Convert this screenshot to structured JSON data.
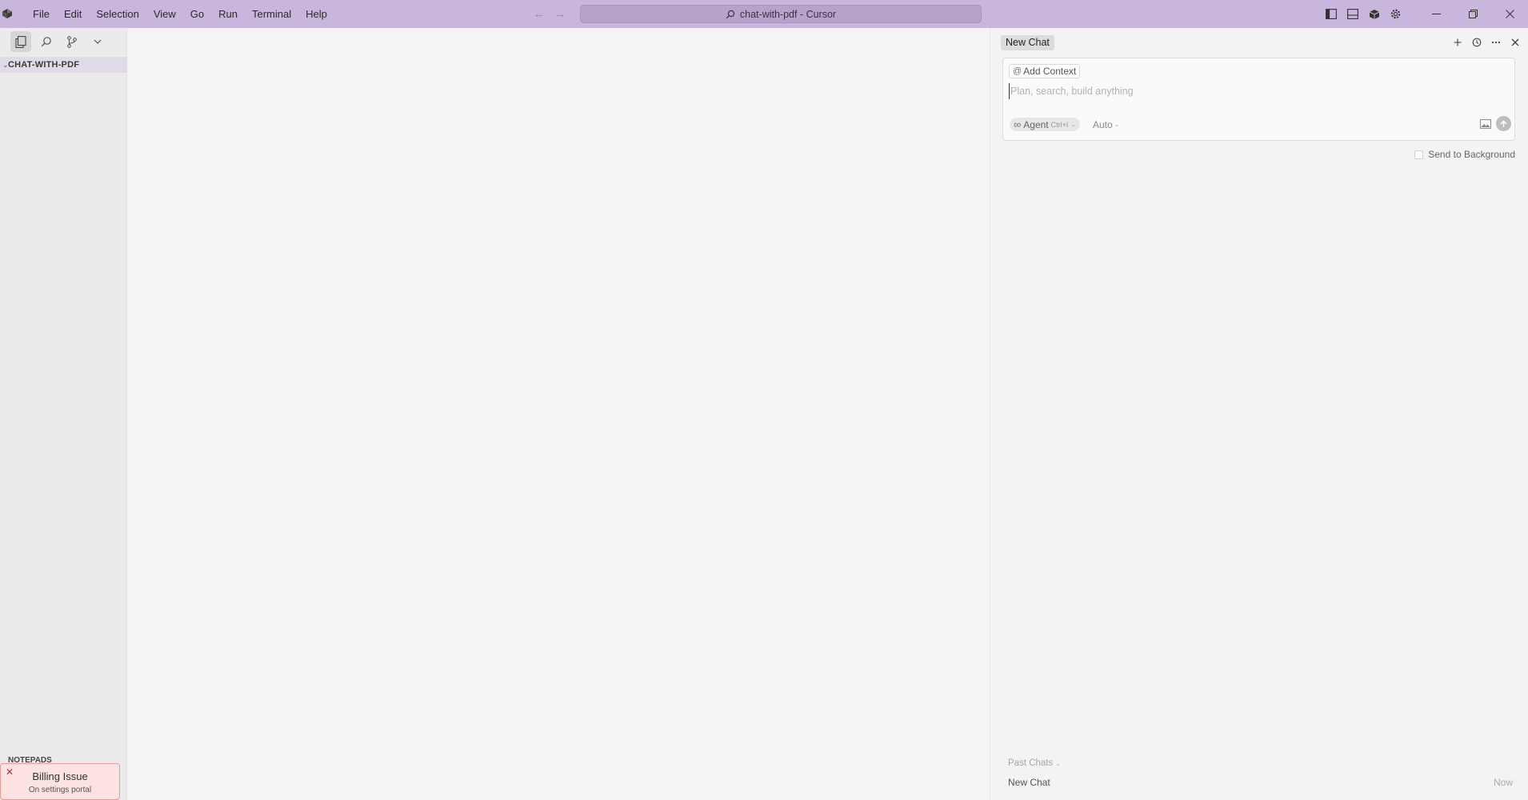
{
  "window": {
    "title": "chat-with-pdf - Cursor"
  },
  "menu": {
    "items": [
      "File",
      "Edit",
      "Selection",
      "View",
      "Go",
      "Run",
      "Terminal",
      "Help"
    ]
  },
  "icons": {
    "app_logo": "cursor-logo-icon",
    "back": "arrow-left-icon",
    "forward": "arrow-right-icon",
    "search": "search-icon",
    "toggle_sidebar": "layout-sidebar-icon",
    "toggle_panel": "layout-panel-icon",
    "extensions": "cube-icon",
    "settings": "gear-icon",
    "minimize": "minimize-icon",
    "restore": "restore-icon",
    "close": "close-icon"
  },
  "sidebar": {
    "explorer_title": "CHAT-WITH-PDF",
    "notepads_title": "NOTEPADS",
    "tools": [
      "explorer-icon",
      "search-icon",
      "source-control-icon",
      "chevron-down-icon"
    ]
  },
  "billing": {
    "title": "Billing Issue",
    "subtitle": "On settings portal"
  },
  "chat": {
    "tab_label": "New Chat",
    "add_context": "Add Context",
    "input_placeholder": "Plan, search, build anything",
    "agent_label": "Agent",
    "agent_shortcut": "Ctrl+I",
    "model_label": "Auto",
    "send_to_background": "Send to Background",
    "past_chats_label": "Past Chats",
    "past_chats": [
      {
        "title": "New Chat",
        "time": "Now"
      }
    ]
  },
  "colors": {
    "titlebar": "#c9b6dc",
    "command_center": "#b7a3ca",
    "billing_bg": "#fde2e2",
    "billing_border": "#e89a9a"
  }
}
